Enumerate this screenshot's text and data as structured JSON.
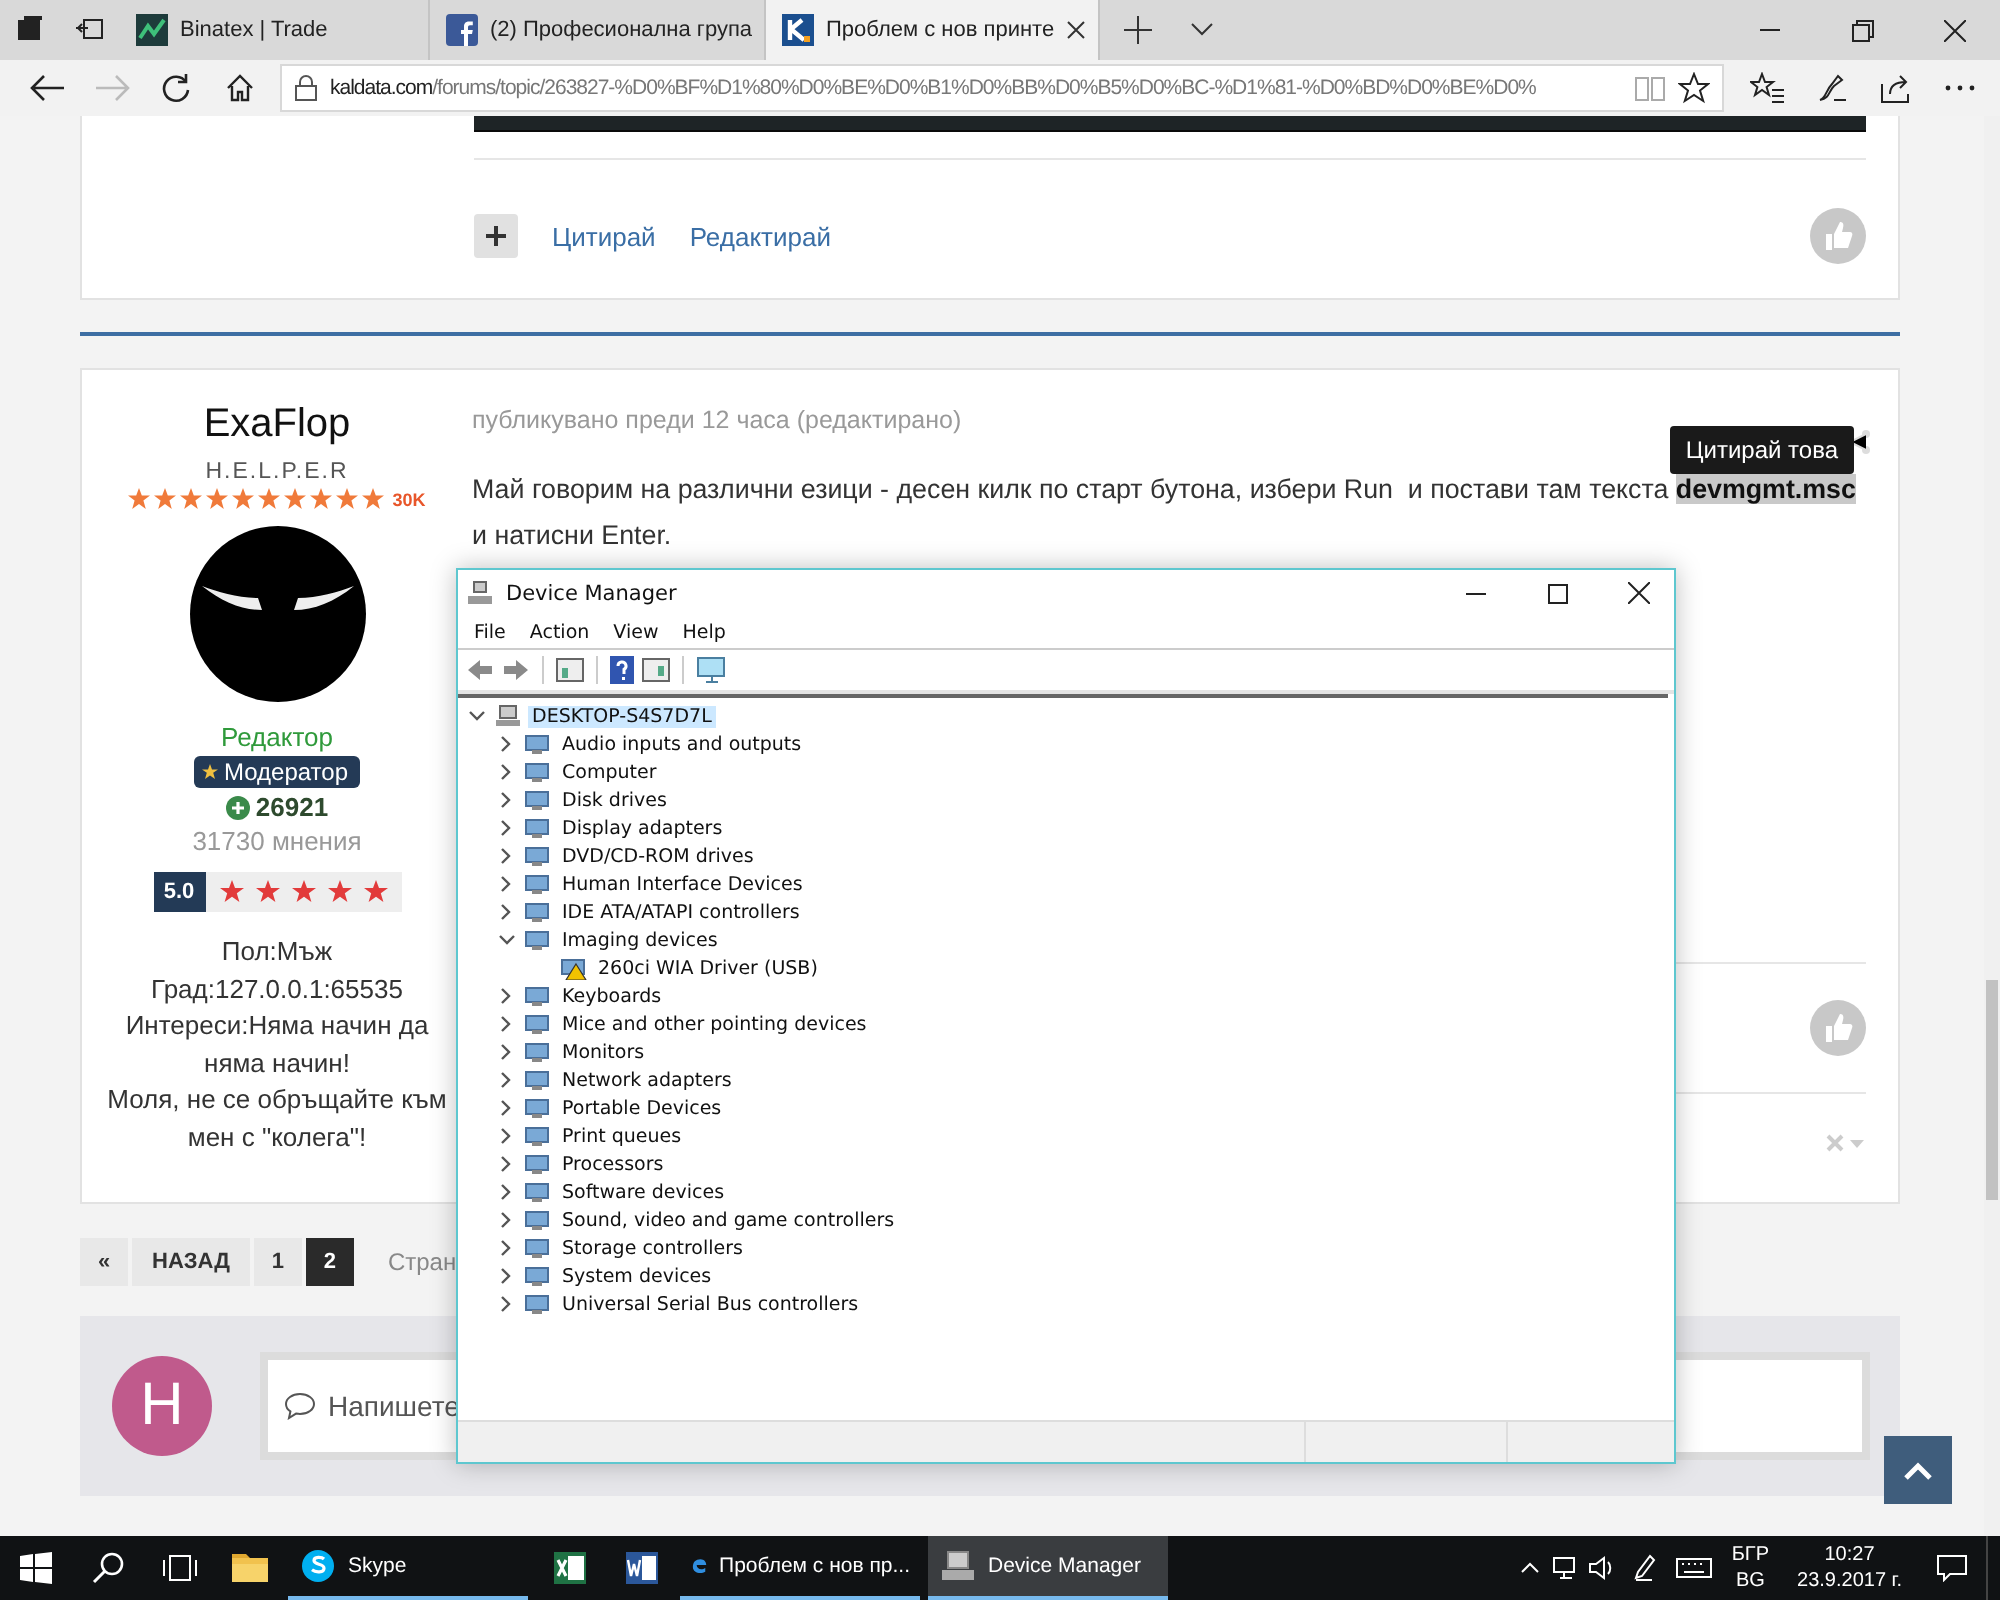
{
  "browser": {
    "tabs": [
      {
        "title": "Binatex | Trade",
        "kind": "chart",
        "selected": false
      },
      {
        "title": "(2) Професионална група",
        "kind": "facebook",
        "selected": false
      },
      {
        "title": "Проблем с нов принте",
        "kind": "kaldata",
        "selected": true
      }
    ],
    "forward": {
      "disabled": true
    },
    "address": {
      "host": "kaldata.com",
      "path": "/forums/topic/263827-%D0%BF%D1%80%D0%BE%D0%B1%D0%BB%D0%B5%D0%BC-%D1%81-%D0%BD%D0%BE%D0%"
    }
  },
  "previous_post": {
    "actions": [
      "Цитирай",
      "Редактирай"
    ]
  },
  "post": {
    "author": {
      "name": "ExaFlop",
      "title": "H.E.L.P.E.R",
      "rank": {
        "stars": 10,
        "label": "30K"
      },
      "group": "Редактор",
      "badge": "Модератор",
      "reputation": "26921",
      "posts": "31730 мнения",
      "rating": {
        "score": "5.0",
        "stars": 5
      },
      "profile": [
        "Пол:Мъж",
        "Град:127.0.0.1:65535",
        "Интереси:Няма начин да няма начин!",
        "Моля, не се обръщайте към мен с \"колега\"!"
      ]
    },
    "meta": "публикувано преди 12 часа (редактирано)",
    "body": "Май говорим на различни езици - десен килк по старт бутона, избери Run  и постави там текста **devmgmt.msc** и натисни Enter.",
    "tooltip": "Цитирай това"
  },
  "pagination": {
    "first": "«",
    "prev": "НАЗАД",
    "pages": [
      {
        "label": "1",
        "selected": false
      },
      {
        "label": "2",
        "selected": true
      }
    ],
    "after": "Стран"
  },
  "reply": {
    "avatar_letter": "H",
    "placeholder": "Напишете"
  },
  "device_manager": {
    "title": "Device Manager",
    "menu": [
      "File",
      "Action",
      "View",
      "Help"
    ],
    "tree": {
      "label": "DESKTOP-S4S7D7L",
      "expanded": true,
      "selected": true,
      "children": [
        {
          "label": "Audio inputs and outputs",
          "expanded": false,
          "selected": false
        },
        {
          "label": "Computer",
          "expanded": false,
          "selected": false
        },
        {
          "label": "Disk drives",
          "expanded": false,
          "selected": false
        },
        {
          "label": "Display adapters",
          "expanded": false,
          "selected": false
        },
        {
          "label": "DVD/CD-ROM drives",
          "expanded": false,
          "selected": false
        },
        {
          "label": "Human Interface Devices",
          "expanded": false,
          "selected": false
        },
        {
          "label": "IDE ATA/ATAPI controllers",
          "expanded": false,
          "selected": false
        },
        {
          "label": "Imaging devices",
          "expanded": true,
          "selected": false,
          "children": [
            {
              "label": "260ci WIA Driver (USB)",
              "selected": false,
              "warning": true
            }
          ]
        },
        {
          "label": "Keyboards",
          "expanded": false,
          "selected": false
        },
        {
          "label": "Mice and other pointing devices",
          "expanded": false,
          "selected": false
        },
        {
          "label": "Monitors",
          "expanded": false,
          "selected": false
        },
        {
          "label": "Network adapters",
          "expanded": false,
          "selected": false
        },
        {
          "label": "Portable Devices",
          "expanded": false,
          "selected": false
        },
        {
          "label": "Print queues",
          "expanded": false,
          "selected": false
        },
        {
          "label": "Processors",
          "expanded": false,
          "selected": false
        },
        {
          "label": "Software devices",
          "expanded": false,
          "selected": false
        },
        {
          "label": "Sound, video and game controllers",
          "expanded": false,
          "selected": false
        },
        {
          "label": "Storage controllers",
          "expanded": false,
          "selected": false
        },
        {
          "label": "System devices",
          "expanded": false,
          "selected": false
        },
        {
          "label": "Universal Serial Bus controllers",
          "expanded": false,
          "selected": false
        }
      ]
    }
  },
  "taskbar": {
    "apps": [
      {
        "kind": "folder",
        "running": false,
        "selected": false
      },
      {
        "kind": "skype",
        "label": "Skype",
        "running": true,
        "selected": false
      },
      {
        "kind": "excel",
        "running": false,
        "selected": false
      },
      {
        "kind": "word",
        "running": false,
        "selected": false
      },
      {
        "kind": "edge",
        "label": "Проблем с нов пр...",
        "running": true,
        "selected": false
      },
      {
        "kind": "devmgr",
        "label": "Device Manager",
        "running": true,
        "selected": true
      }
    ],
    "language": [
      "БГР",
      "BG"
    ],
    "time": "10:27",
    "date": "23.9.2017 г."
  }
}
